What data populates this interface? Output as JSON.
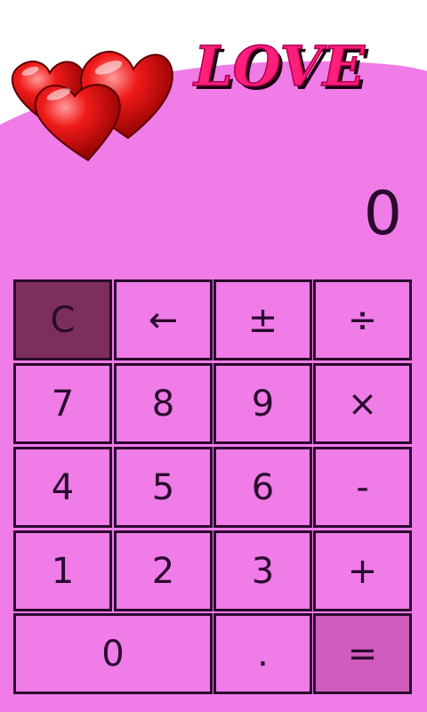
{
  "logo": {
    "text": "LOVE"
  },
  "display": {
    "value": "0"
  },
  "colors": {
    "background": "#f07ce8",
    "key_border": "#2a0a2e",
    "clear_key": "#7e2e5c",
    "equals_key": "#cf5cbd",
    "logo_text": "#ff1f7a"
  },
  "keys": {
    "clear": "C",
    "backspace": "←",
    "sign": "±",
    "divide": "÷",
    "seven": "7",
    "eight": "8",
    "nine": "9",
    "multiply": "×",
    "four": "4",
    "five": "5",
    "six": "6",
    "minus": "-",
    "one": "1",
    "two": "2",
    "three": "3",
    "plus": "+",
    "zero": "0",
    "decimal": ".",
    "equals": "="
  }
}
